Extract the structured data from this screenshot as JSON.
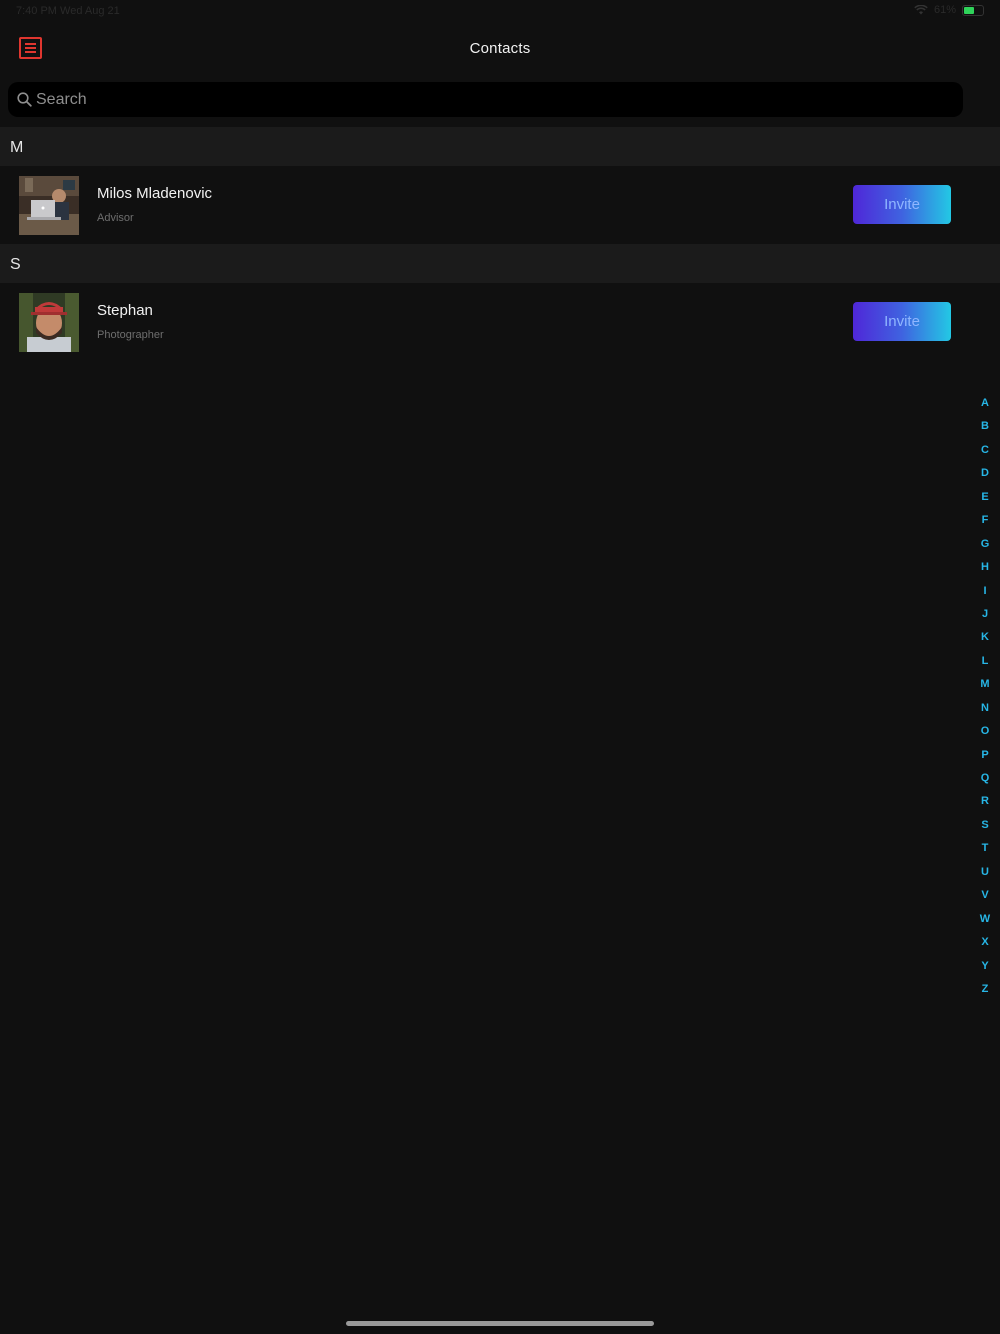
{
  "status": {
    "time": "7:40 PM  Wed Aug 21",
    "battery": "61%",
    "battery_color": "#2fd35a"
  },
  "nav": {
    "title": "Contacts",
    "menu_icon": "menu-icon",
    "accent": "#e0362f"
  },
  "search": {
    "placeholder": "Search",
    "icon": "search-icon"
  },
  "sections": [
    {
      "letter": "M",
      "contacts": [
        {
          "name": "Milos Mladenovic",
          "role": "Advisor",
          "action": "Invite"
        }
      ]
    },
    {
      "letter": "S",
      "contacts": [
        {
          "name": "Stephan",
          "role": "Photographer",
          "action": "Invite"
        }
      ]
    }
  ],
  "index": [
    "A",
    "B",
    "C",
    "D",
    "E",
    "F",
    "G",
    "H",
    "I",
    "J",
    "K",
    "L",
    "M",
    "N",
    "O",
    "P",
    "Q",
    "R",
    "S",
    "T",
    "U",
    "V",
    "W",
    "X",
    "Y",
    "Z"
  ],
  "colors": {
    "background": "#101010",
    "section_header": "#1b1b1b",
    "index": "#27b6e6",
    "button_gradient_start": "#4f27d8",
    "button_gradient_end": "#23c8e4"
  }
}
